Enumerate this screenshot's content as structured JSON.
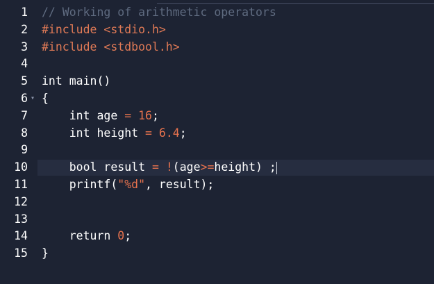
{
  "editor": {
    "fold_marker": "▾",
    "lines": [
      {
        "num": "1",
        "tokens": [
          {
            "t": "// Working of arithmetic operators",
            "c": "cm"
          }
        ]
      },
      {
        "num": "2",
        "tokens": [
          {
            "t": "#include ",
            "c": "pp"
          },
          {
            "t": "<stdio.h>",
            "c": "pp"
          }
        ]
      },
      {
        "num": "3",
        "tokens": [
          {
            "t": "#include ",
            "c": "pp"
          },
          {
            "t": "<stdbool.h>",
            "c": "pp"
          }
        ]
      },
      {
        "num": "4",
        "tokens": []
      },
      {
        "num": "5",
        "tokens": [
          {
            "t": "int",
            "c": "kw"
          },
          {
            "t": " main()",
            "c": ""
          }
        ]
      },
      {
        "num": "6",
        "fold": true,
        "tokens": [
          {
            "t": "{",
            "c": ""
          }
        ]
      },
      {
        "num": "7",
        "tokens": [
          {
            "t": "    ",
            "c": ""
          },
          {
            "t": "int",
            "c": "kw"
          },
          {
            "t": " age ",
            "c": ""
          },
          {
            "t": "=",
            "c": "op"
          },
          {
            "t": " ",
            "c": ""
          },
          {
            "t": "16",
            "c": "num"
          },
          {
            "t": ";",
            "c": ""
          }
        ]
      },
      {
        "num": "8",
        "tokens": [
          {
            "t": "    ",
            "c": ""
          },
          {
            "t": "int",
            "c": "kw"
          },
          {
            "t": " height ",
            "c": ""
          },
          {
            "t": "=",
            "c": "op"
          },
          {
            "t": " ",
            "c": ""
          },
          {
            "t": "6.4",
            "c": "num"
          },
          {
            "t": ";",
            "c": ""
          }
        ]
      },
      {
        "num": "9",
        "tokens": []
      },
      {
        "num": "10",
        "active": true,
        "cursor": true,
        "tokens": [
          {
            "t": "    ",
            "c": ""
          },
          {
            "t": "bool",
            "c": "kw"
          },
          {
            "t": " result ",
            "c": ""
          },
          {
            "t": "=",
            "c": "op"
          },
          {
            "t": " ",
            "c": ""
          },
          {
            "t": "!",
            "c": "op"
          },
          {
            "t": "(age",
            "c": ""
          },
          {
            "t": ">=",
            "c": "op"
          },
          {
            "t": "height) ;",
            "c": ""
          }
        ]
      },
      {
        "num": "11",
        "tokens": [
          {
            "t": "    printf(",
            "c": ""
          },
          {
            "t": "\"%d\"",
            "c": "str"
          },
          {
            "t": ", result);",
            "c": ""
          }
        ]
      },
      {
        "num": "12",
        "tokens": []
      },
      {
        "num": "13",
        "tokens": []
      },
      {
        "num": "14",
        "tokens": [
          {
            "t": "    ",
            "c": ""
          },
          {
            "t": "return",
            "c": "kw"
          },
          {
            "t": " ",
            "c": ""
          },
          {
            "t": "0",
            "c": "num"
          },
          {
            "t": ";",
            "c": ""
          }
        ]
      },
      {
        "num": "15",
        "tokens": [
          {
            "t": "}",
            "c": ""
          }
        ]
      }
    ]
  }
}
